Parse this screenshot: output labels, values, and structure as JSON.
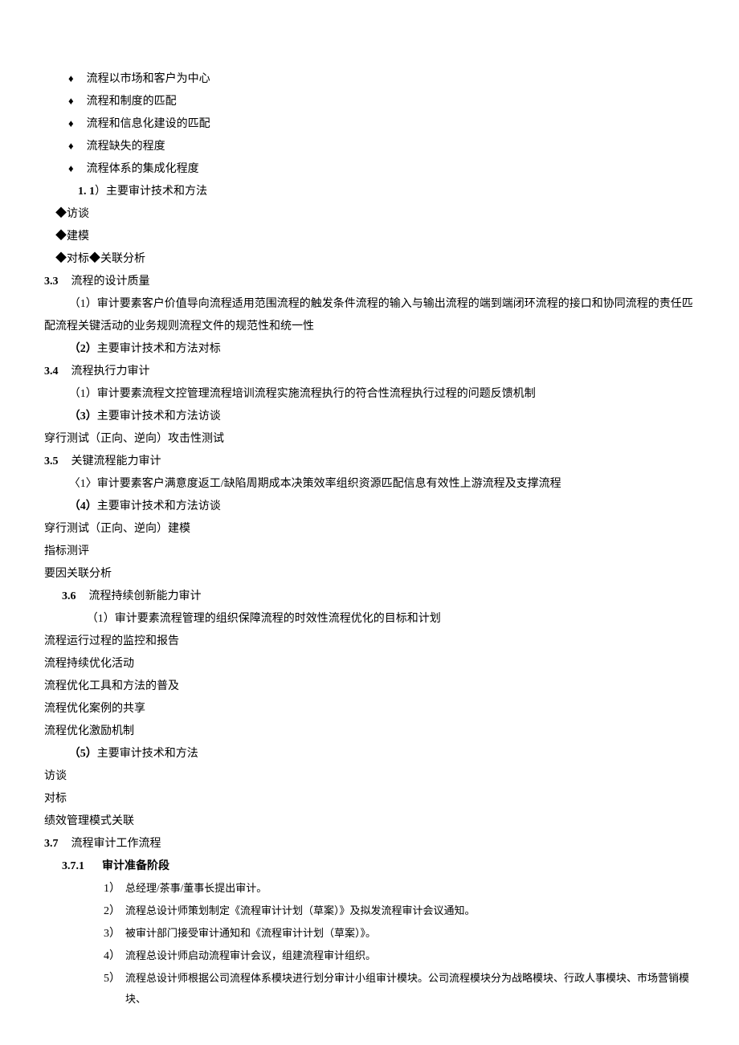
{
  "diamonds": [
    "流程以市场和客户为中心",
    "流程和制度的匹配",
    "流程和信息化建设的匹配",
    "流程缺失的程度",
    "流程体系的集成化程度"
  ],
  "sec1_1_num": "1. 1",
  "sec1_1_title": "）主要审计技术和方法",
  "builders": {
    "interview": "◆访谈",
    "modeling": "◆建模",
    "bench": "◆对标◆关联分析"
  },
  "s33": {
    "num": "3.3",
    "title": "流程的设计质量",
    "p1": "（1）审计要素客户价值导向流程适用范围流程的触发条件流程的输入与输出流程的端到端闭环流程的接口和协同流程的责任匹配流程关键活动的业务规则流程文件的规范性和统一性",
    "p2": "（2）主要审计技术和方法对标"
  },
  "s34": {
    "num": "3.4",
    "title": "流程执行力审计",
    "p1": "（1）审计要素流程文控管理流程培训流程实施流程执行的符合性流程执行过程的问题反馈机制",
    "p2": "（3）主要审计技术和方法访谈",
    "p3": "穿行测试（正向、逆向）攻击性测试"
  },
  "s35": {
    "num": "3.5",
    "title": "关键流程能力审计",
    "p1": "〈1〉审计要素客户满意度返工/缺陷周期成本决策效率组织资源匹配信息有效性上游流程及支撑流程",
    "p2": "（4）主要审计技术和方法访谈",
    "p3": "穿行测试（正向、逆向）建模",
    "p4": "指标测评",
    "p5": "要因关联分析"
  },
  "s36": {
    "num": "3.6",
    "title": "流程持续创新能力审计",
    "p1": "（1）审计要素流程管理的组织保障流程的时效性流程优化的目标和计划",
    "lines": [
      "流程运行过程的监控和报告",
      "流程持续优化活动",
      "流程优化工具和方法的普及",
      "流程优化案例的共享",
      "流程优化激励机制"
    ],
    "p2": "（5）主要审计技术和方法",
    "lines2": [
      "访谈",
      "对标",
      "绩效管理模式关联"
    ]
  },
  "s37": {
    "num": "3.7",
    "title": "流程审计工作流程",
    "sub_num": "3.7.1",
    "sub_title": "审计准备阶段",
    "steps": [
      {
        "label": "1）",
        "text": "总经理/茶事/董事长提出审计。"
      },
      {
        "label": "2）",
        "text": "流程总设计师策划制定《流程审计计划（草案）》及拟发流程审计会议通知。"
      },
      {
        "label": "3）",
        "text": "被审计部门接受审计通知和《流程审计计划（草案）》。"
      },
      {
        "label": "4）",
        "text": "流程总设计师启动流程审计会议，组建流程审计组织。"
      },
      {
        "label": "5）",
        "text": "流程总设计师根据公司流程体系模块进行划分审计小组审计模块。公司流程模块分为战略模块、行政人事模块、市场营销模块、"
      }
    ]
  }
}
